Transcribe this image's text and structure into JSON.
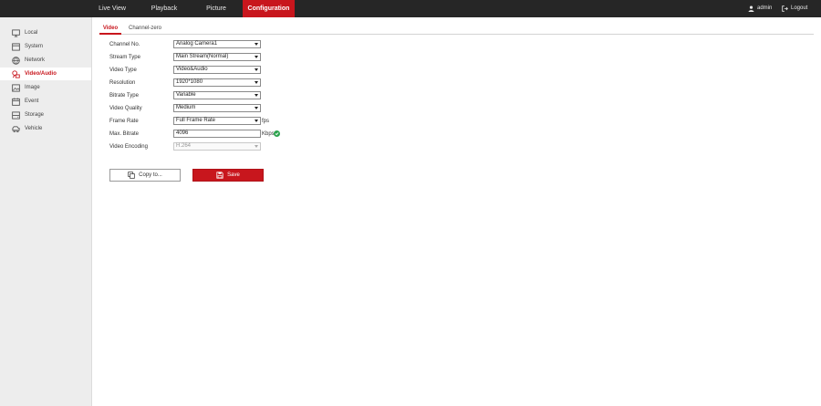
{
  "topnav": {
    "items": [
      {
        "label": "Live View"
      },
      {
        "label": "Playback"
      },
      {
        "label": "Picture"
      },
      {
        "label": "Configuration",
        "active": true
      }
    ],
    "user": "admin",
    "logout": "Logout"
  },
  "sidebar": {
    "items": [
      {
        "label": "Local",
        "icon": "monitor-icon"
      },
      {
        "label": "System",
        "icon": "system-icon"
      },
      {
        "label": "Network",
        "icon": "globe-icon"
      },
      {
        "label": "Video/Audio",
        "icon": "video-audio-icon",
        "active": true
      },
      {
        "label": "Image",
        "icon": "image-icon"
      },
      {
        "label": "Event",
        "icon": "calendar-icon"
      },
      {
        "label": "Storage",
        "icon": "storage-icon"
      },
      {
        "label": "Vehicle",
        "icon": "vehicle-icon"
      }
    ]
  },
  "tabs": [
    {
      "label": "Video",
      "active": true
    },
    {
      "label": "Channel-zero"
    }
  ],
  "form": {
    "channel_no": {
      "label": "Channel No.",
      "value": "Analog Camera1"
    },
    "stream_type": {
      "label": "Stream Type",
      "value": "Main Stream(Normal)"
    },
    "video_type": {
      "label": "Video Type",
      "value": "Video&Audio"
    },
    "resolution": {
      "label": "Resolution",
      "value": "1920*1080"
    },
    "bitrate_type": {
      "label": "Bitrate Type",
      "value": "Variable"
    },
    "video_quality": {
      "label": "Video Quality",
      "value": "Medium"
    },
    "frame_rate": {
      "label": "Frame Rate",
      "value": "Full Frame Rate",
      "unit": "fps"
    },
    "max_bitrate": {
      "label": "Max. Bitrate",
      "value": "4096",
      "unit": "Kbps"
    },
    "video_encoding": {
      "label": "Video Encoding",
      "value": "H.264"
    }
  },
  "buttons": {
    "copy": "Copy to...",
    "save": "Save"
  },
  "colors": {
    "accent": "#c8161d",
    "topbar": "#262626",
    "sidebar": "#ededed",
    "ok": "#2ea44f"
  }
}
